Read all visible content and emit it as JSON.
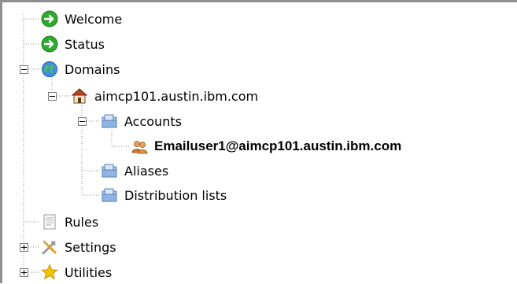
{
  "tree": {
    "welcome": {
      "label": "Welcome",
      "icon": "green-arrow-icon"
    },
    "status": {
      "label": "Status",
      "icon": "green-arrow-icon"
    },
    "domains": {
      "label": "Domains",
      "icon": "globe-icon",
      "expanded": true
    },
    "domain": {
      "label": "aimcp101.austin.ibm.com",
      "icon": "house-icon",
      "expanded": true
    },
    "accounts": {
      "label": "Accounts",
      "icon": "folder-icon",
      "expanded": true
    },
    "account_user": {
      "label": "Emailuser1@aimcp101.austin.ibm.com",
      "icon": "users-icon",
      "selected": true
    },
    "aliases": {
      "label": "Aliases",
      "icon": "folder-icon"
    },
    "distribution_lists": {
      "label": "Distribution lists",
      "icon": "folder-icon"
    },
    "rules": {
      "label": "Rules",
      "icon": "document-icon"
    },
    "settings": {
      "label": "Settings",
      "icon": "tools-icon",
      "expanded": false
    },
    "utilities": {
      "label": "Utilities",
      "icon": "star-icon",
      "expanded": false
    }
  },
  "colors": {
    "border": "#8f8f8f",
    "connector": "#8a8a8a",
    "green": "#2faa2f",
    "star": "#f5c400"
  }
}
